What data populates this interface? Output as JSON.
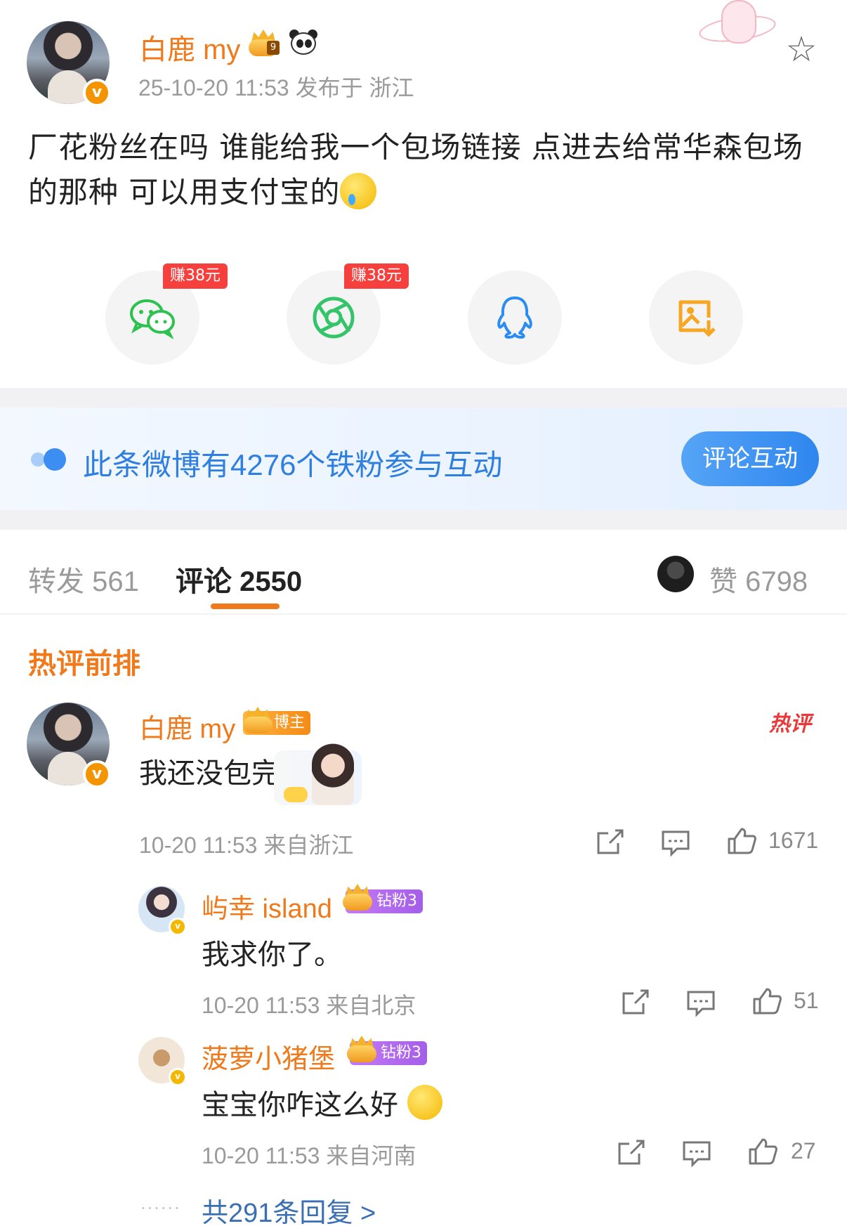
{
  "post": {
    "author": "白鹿 my",
    "author_level": "9",
    "meta": "25-10-20 11:53  发布于 浙江",
    "text": "厂花粉丝在吗 谁能给我一个包场链接 点进去给常华森包场的那种 可以用支付宝的",
    "emoji": "crying-face"
  },
  "share": {
    "earn_badge_wechat": "赚38元",
    "earn_badge_moments": "赚38元",
    "items": [
      "wechat",
      "wechat-moments",
      "qq",
      "save-image"
    ]
  },
  "fan_banner": {
    "text": "此条微博有4276个铁粉参与互动",
    "cta": "评论互动"
  },
  "tabs": {
    "repost_label": "转发",
    "repost_count": "561",
    "comment_label": "评论",
    "comment_count": "2550",
    "like_label": "赞",
    "like_count": "6798"
  },
  "hot": {
    "title": "热评前排",
    "tag": "热评"
  },
  "top_comment": {
    "author": "白鹿 my",
    "badge": "博主",
    "text": "我还没包完",
    "meta": "10-20 11:53  来自浙江",
    "likes": "1671"
  },
  "replies": [
    {
      "author": "屿幸 island",
      "badge": "钻粉3",
      "text": "我求你了。",
      "meta": "10-20 11:53  来自北京",
      "likes": "51"
    },
    {
      "author": "菠萝小猪堡",
      "badge": "钻粉3",
      "text": "宝宝你咋这么好",
      "meta": "10-20 11:53  来自河南",
      "likes": "27"
    }
  ],
  "more_replies": "共291条回复 >",
  "colors": {
    "accent_orange": "#f07a1b",
    "link_blue": "#2f7fe0",
    "fan_chip_purple": "#b46cf0",
    "hot_red": "#e83a3a"
  }
}
